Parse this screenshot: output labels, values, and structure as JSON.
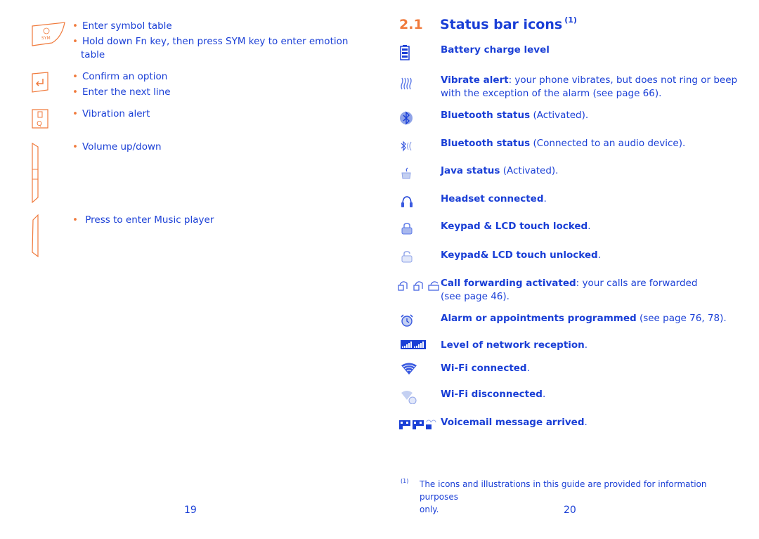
{
  "left_page": {
    "keys": [
      {
        "icon": "sym-key-icon",
        "bullets": [
          "Enter symbol table",
          "Hold down Fn key, then press SYM key to enter emotion",
          "table"
        ]
      },
      {
        "icon": "enter-key-icon",
        "bullets": [
          "Confirm an option",
          "Enter the next line"
        ]
      },
      {
        "icon": "vibration-q-key-icon",
        "bullets": [
          "Vibration alert"
        ]
      },
      {
        "icon": "volume-side-key-icon",
        "bullets": [
          "Volume up/down"
        ]
      },
      {
        "icon": "music-side-key-icon",
        "bullets": [
          "Press to enter Music player"
        ]
      }
    ],
    "page_number": "19"
  },
  "right_page": {
    "section_number": "2.1",
    "section_title": "Status bar icons",
    "section_footnote_ref": "(1)",
    "items": [
      {
        "icon": "battery-icon",
        "bold": "Battery charge level",
        "text": ""
      },
      {
        "icon": "vibrate-icon",
        "bold": "Vibrate alert",
        "text": ": your phone vibrates, but does not ring or beep",
        "text2": "with the exception of the alarm (see page 66)."
      },
      {
        "icon": "bluetooth-activated-icon",
        "bold": "Bluetooth status",
        "text": " (Activated)."
      },
      {
        "icon": "bluetooth-connected-icon",
        "bold": "Bluetooth status",
        "text": " (Connected to an audio device)."
      },
      {
        "icon": "java-icon",
        "bold": "Java status",
        "text": " (Activated)."
      },
      {
        "icon": "headset-icon",
        "bold": "Headset connected",
        "text": "."
      },
      {
        "icon": "lock-icon",
        "bold": "Keypad & LCD touch locked",
        "text": "."
      },
      {
        "icon": "unlock-icon",
        "bold": "Keypad& LCD touch unlocked",
        "text": "."
      },
      {
        "icon": "call-forwarding-icon",
        "bold": "Call forwarding activated",
        "text": ": your calls are forwarded",
        "text2": "(see page 46)."
      },
      {
        "icon": "alarm-icon",
        "bold": "Alarm or appointments programmed",
        "text": " (see page 76, 78)."
      },
      {
        "icon": "network-reception-icon",
        "bold": "Level of network reception",
        "text": "."
      },
      {
        "icon": "wifi-connected-icon",
        "bold": "Wi-Fi connected",
        "text": "."
      },
      {
        "icon": "wifi-disconnected-icon",
        "bold": "Wi-Fi disconnected",
        "text": "."
      },
      {
        "icon": "voicemail-icon",
        "bold": "Voicemail message arrived",
        "text": "."
      }
    ],
    "footnote_mark": "(1)",
    "footnote_text": "The icons and illustrations in this guide are provided for information purposes",
    "footnote_text2": "only.",
    "page_number": "20"
  },
  "colors": {
    "text": "#1a3fd6",
    "accent": "#f07a3c"
  }
}
